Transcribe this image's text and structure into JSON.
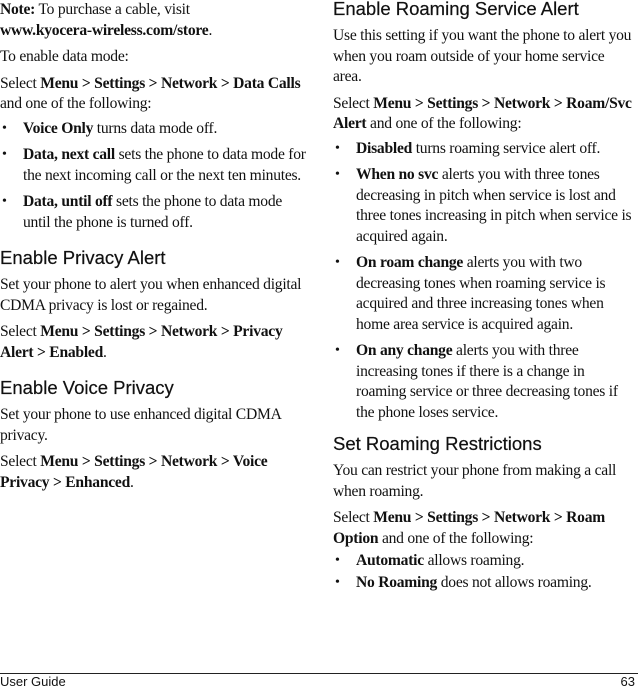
{
  "left": {
    "note": {
      "label": "Note:",
      "text": " To purchase a cable, visit ",
      "url": "www.kyocera-wireless.com/store",
      "end": "."
    },
    "data_mode": {
      "intro": "To enable data mode:",
      "select_prefix": "Select ",
      "select_path": "Menu > Settings > Network > Data Calls",
      "select_suffix": " and one of the following:",
      "items": [
        {
          "term": "Voice Only",
          "desc": " turns data mode off."
        },
        {
          "term": "Data, next call",
          "desc": " sets the phone to data mode for the next incoming call or the next ten minutes."
        },
        {
          "term": "Data, until off",
          "desc": " sets the phone to data mode until the phone is turned off."
        }
      ]
    },
    "privacy_alert": {
      "heading": "Enable Privacy Alert",
      "body": "Set your phone to alert you when enhanced digital CDMA privacy is lost or regained.",
      "select_prefix": "Select ",
      "select_path": "Menu > Settings > Network > Privacy Alert > Enabled",
      "select_suffix": "."
    },
    "voice_privacy": {
      "heading": "Enable Voice Privacy",
      "body": "Set your phone to use enhanced digital CDMA privacy.",
      "select_prefix": "Select ",
      "select_path": "Menu > Settings > Network > Voice Privacy > Enhanced",
      "select_suffix": "."
    }
  },
  "right": {
    "roaming_alert": {
      "heading": "Enable Roaming Service Alert",
      "body": "Use this setting if you want the phone to alert you when you roam outside of your home service area.",
      "select_prefix": "Select ",
      "select_path": "Menu > Settings > Network > Roam/Svc Alert",
      "select_suffix": " and one of the following:",
      "items": [
        {
          "term": "Disabled",
          "desc": " turns roaming service alert off."
        },
        {
          "term": "When no svc",
          "desc": " alerts you with three tones decreasing in pitch when service is lost and three tones increasing in pitch when service is acquired again."
        },
        {
          "term": "On roam change",
          "desc": " alerts you with two decreasing tones when roaming service is acquired and three increasing tones when home area service is acquired again."
        },
        {
          "term": "On any change",
          "desc": " alerts you with three increasing tones if there is a change in roaming service or three decreasing tones if the phone loses service."
        }
      ]
    },
    "roaming_restrictions": {
      "heading": "Set Roaming Restrictions",
      "body": "You can restrict your phone from making a call when roaming.",
      "select_prefix": "Select ",
      "select_path": "Menu > Settings > Network > Roam Option",
      "select_suffix": " and one of the following:",
      "items": [
        {
          "term": "Automatic",
          "desc": " allows roaming."
        },
        {
          "term": "No Roaming",
          "desc": " does not allows roaming."
        }
      ]
    }
  },
  "footer": {
    "title": "User Guide",
    "page_number": "63"
  },
  "bullet_glyph": "•"
}
